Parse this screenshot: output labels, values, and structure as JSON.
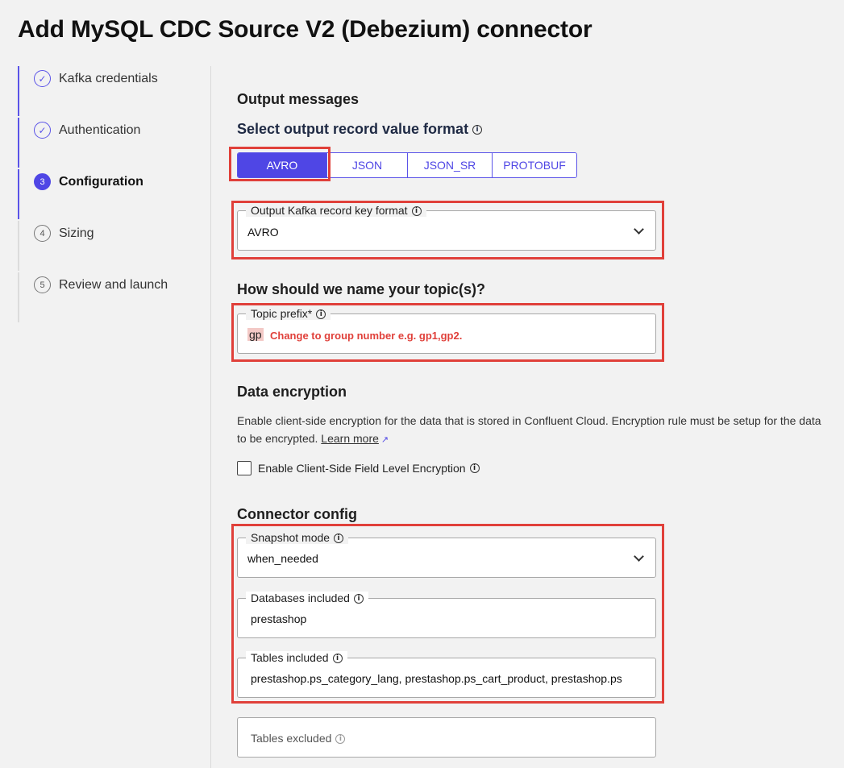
{
  "page": {
    "title": "Add MySQL CDC Source V2 (Debezium) connector"
  },
  "stepper": {
    "steps": [
      {
        "label": "Kafka credentials",
        "state": "done",
        "marker": "✓"
      },
      {
        "label": "Authentication",
        "state": "done",
        "marker": "✓"
      },
      {
        "label": "Configuration",
        "state": "current",
        "marker": "3"
      },
      {
        "label": "Sizing",
        "state": "pending",
        "marker": "4"
      },
      {
        "label": "Review and launch",
        "state": "pending",
        "marker": "5"
      }
    ]
  },
  "output": {
    "section_title": "Output messages",
    "value_format_label": "Select output record value format",
    "formats": [
      "AVRO",
      "JSON",
      "JSON_SR",
      "PROTOBUF"
    ],
    "selected_format": "AVRO",
    "key_format": {
      "label": "Output Kafka record key format",
      "value": "AVRO"
    }
  },
  "topic": {
    "section_title": "How should we name your topic(s)?",
    "prefix_label": "Topic prefix*",
    "prefix_value": "gp",
    "annotation": "Change to group number e.g. gp1,gp2."
  },
  "encryption": {
    "section_title": "Data encryption",
    "description": "Enable client-side encryption for the data that is stored in Confluent Cloud. Encryption rule must be setup for the data to be encrypted.",
    "learn_more": "Learn more",
    "checkbox_label": "Enable Client-Side Field Level Encryption",
    "checked": false
  },
  "connector_config": {
    "section_title": "Connector config",
    "snapshot_mode": {
      "label": "Snapshot mode",
      "value": "when_needed"
    },
    "databases_included": {
      "label": "Databases included",
      "value": "prestashop"
    },
    "tables_included": {
      "label": "Tables included",
      "value": "prestashop.ps_category_lang, prestashop.ps_cart_product, prestashop.ps"
    },
    "tables_excluded": {
      "label": "Tables excluded",
      "value": ""
    }
  },
  "colors": {
    "accent": "#4f46e5",
    "annotation_red": "#e0403a"
  }
}
